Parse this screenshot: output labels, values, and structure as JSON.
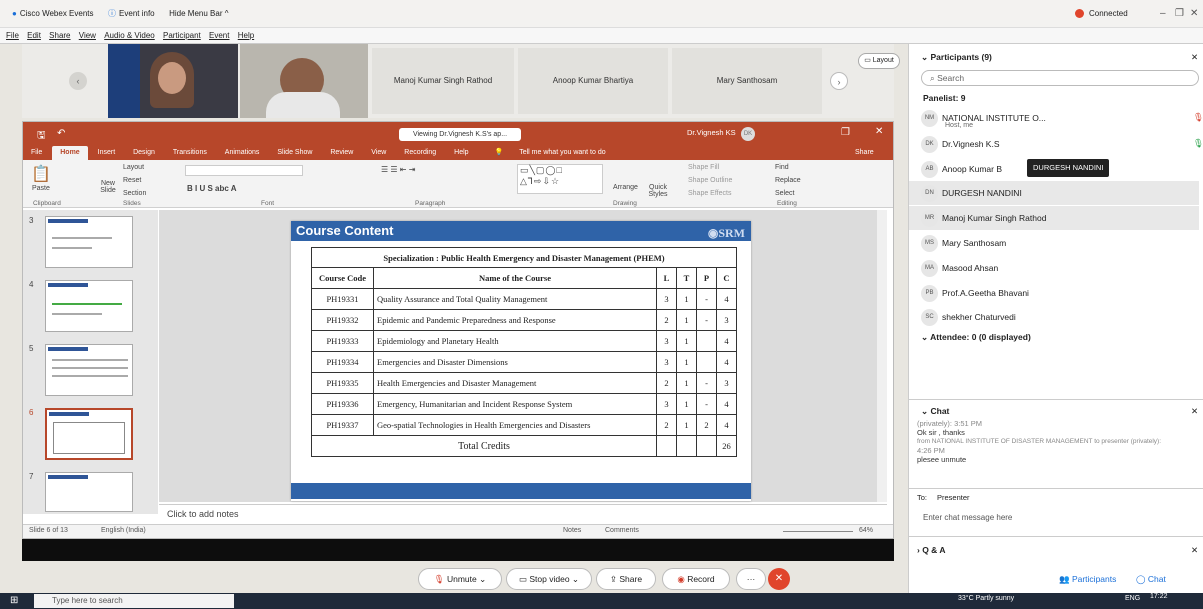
{
  "webex": {
    "app_title": "Cisco Webex Events",
    "event_info": "Event info",
    "hide_menu": "Hide Menu Bar ^",
    "status": "Connected",
    "menu": [
      "File",
      "Edit",
      "Share",
      "View",
      "Audio & Video",
      "Participant",
      "Event",
      "Help"
    ],
    "tiles": [
      "Manoj  Kumar Singh Rathod",
      "Anoop Kumar Bhartiya",
      "Mary Santhosam"
    ],
    "layout_label": "Layout"
  },
  "ppt": {
    "viewing": "Viewing Dr.Vignesh K.S's ap...",
    "user": "Dr.Vignesh KS",
    "tabs": [
      "File",
      "Home",
      "Insert",
      "Design",
      "Transitions",
      "Animations",
      "Slide Show",
      "Review",
      "View",
      "Recording",
      "Help"
    ],
    "tell_me": "Tell me what you want to do",
    "share": "Share",
    "groups": [
      "Clipboard",
      "Slides",
      "Font",
      "Paragraph",
      "Drawing",
      "Editing"
    ],
    "ribbon": {
      "paste": "Paste",
      "new_slide": "New Slide",
      "layout": "Layout",
      "reset": "Reset",
      "section": "Section",
      "arrange": "Arrange",
      "quick_styles": "Quick Styles",
      "shape_fill": "Shape Fill",
      "shape_outline": "Shape Outline",
      "shape_effects": "Shape Effects",
      "find": "Find",
      "replace": "Replace",
      "select": "Select"
    },
    "thumb_numbers": [
      "3",
      "4",
      "5",
      "6",
      "7"
    ],
    "notes_placeholder": "Click to add notes",
    "status_slide": "Slide 6 of 13",
    "status_lang": "English (India)",
    "notes_btn": "Notes",
    "comments_btn": "Comments",
    "zoom": "64%"
  },
  "slide": {
    "header": "Course Content",
    "logo": "SRM",
    "specialization": "Specialization : Public Health Emergency and Disaster Management (PHEM)",
    "columns": [
      "Course Code",
      "Name of the Course",
      "L",
      "T",
      "P",
      "C"
    ],
    "rows": [
      [
        "PH19331",
        "Quality Assurance and Total Quality Management",
        "3",
        "1",
        "-",
        "4"
      ],
      [
        "PH19332",
        "Epidemic and Pandemic Preparedness and Response",
        "2",
        "1",
        "-",
        "3"
      ],
      [
        "PH19333",
        "Epidemiology and Planetary Health",
        "3",
        "1",
        "",
        "4"
      ],
      [
        "PH19334",
        "Emergencies and Disaster Dimensions",
        "3",
        "1",
        "",
        "4"
      ],
      [
        "PH19335",
        "Health Emergencies and Disaster Management",
        "2",
        "1",
        "-",
        "3"
      ],
      [
        "PH19336",
        "Emergency, Humanitarian and Incident Response System",
        "3",
        "1",
        "-",
        "4"
      ],
      [
        "PH19337",
        "Geo-spatial Technologies in Health Emergencies and Disasters",
        "2",
        "1",
        "2",
        "4"
      ]
    ],
    "total_label": "Total Credits",
    "total_value": "26"
  },
  "controls": {
    "unmute": "Unmute",
    "stop_video": "Stop video",
    "share": "Share",
    "record": "Record"
  },
  "panel": {
    "participants_title": "Participants (9)",
    "search_placeholder": "Search",
    "panelist_header": "Panelist: 9",
    "participants": [
      {
        "initials": "NM",
        "name": "NATIONAL INSTITUTE O...",
        "sub": "Host, me"
      },
      {
        "initials": "DK",
        "name": "Dr.Vignesh K.S",
        "sub": ""
      },
      {
        "initials": "AB",
        "name": "Anoop Kumar B",
        "sub": ""
      },
      {
        "initials": "DN",
        "name": "DURGESH NANDINI",
        "sub": ""
      },
      {
        "initials": "MR",
        "name": "Manoj  Kumar Singh Rathod",
        "sub": ""
      },
      {
        "initials": "MS",
        "name": "Mary Santhosam",
        "sub": ""
      },
      {
        "initials": "MA",
        "name": "Masood Ahsan",
        "sub": ""
      },
      {
        "initials": "PB",
        "name": "Prof.A.Geetha Bhavani",
        "sub": ""
      },
      {
        "initials": "SC",
        "name": "shekher  Chaturvedi",
        "sub": ""
      }
    ],
    "tooltip": "DURGESH NANDINI",
    "attendee_header": "Attendee: 0 (0 displayed)",
    "chat_title": "Chat",
    "chat_lines": [
      "(privately): 3:51 PM",
      "Ok sir , thanks",
      "from NATIONAL INSTITUTE OF DISASTER MANAGEMENT to presenter (privately):",
      "4:26 PM",
      "plesee unmute"
    ],
    "to_label": "To:",
    "to_value": "Presenter",
    "chat_placeholder": "Enter chat message here",
    "qa_title": "Q & A",
    "participants_btn": "Participants",
    "chat_btn": "Chat"
  },
  "taskbar": {
    "search": "Type here to search",
    "weather": "33°C  Partly sunny",
    "lang": "ENG",
    "time": "17:22"
  }
}
